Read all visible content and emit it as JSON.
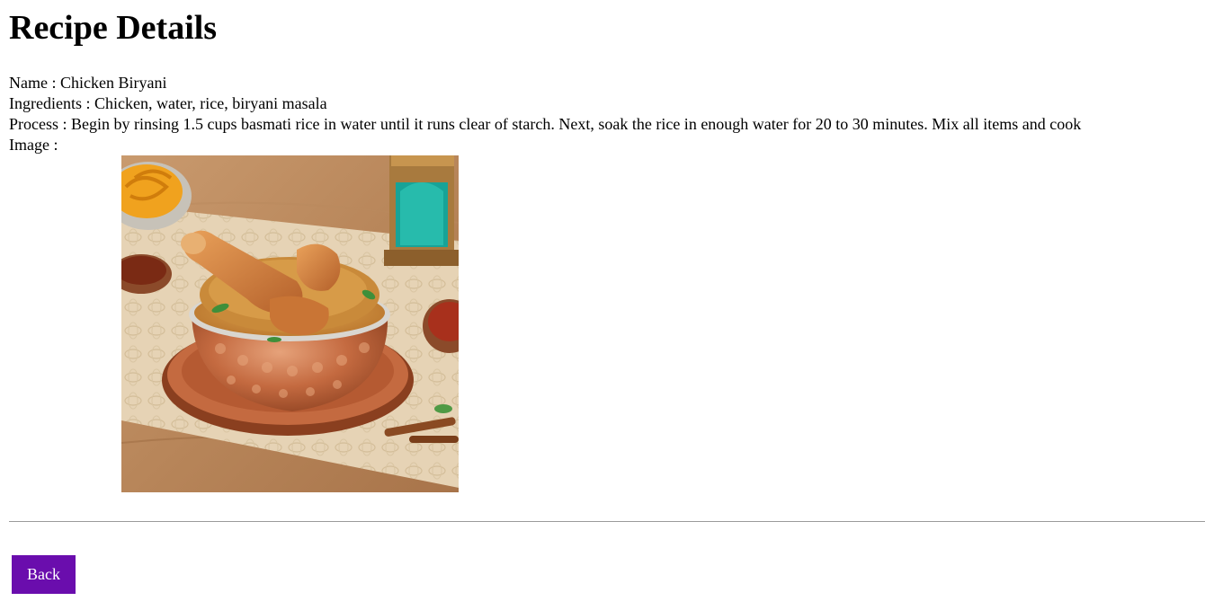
{
  "page": {
    "title": "Recipe Details"
  },
  "recipe": {
    "name_label": "Name : ",
    "name": "Chicken Biryani",
    "ingredients_label": "Ingredients : ",
    "ingredients": "Chicken, water, rice, biryani masala",
    "process_label": "Process : ",
    "process": "Begin by rinsing 1.5 cups basmati rice in water until it runs clear of starch. Next, soak the rice in enough water for 20 to 30 minutes. Mix all items and cook",
    "image_label": "Image :",
    "image_icon": "chicken-biryani-photo"
  },
  "actions": {
    "back_label": "Back"
  },
  "colors": {
    "back_button_bg": "#6a0dad",
    "back_button_text": "#ffffff",
    "divider": "#9a9a9a"
  }
}
